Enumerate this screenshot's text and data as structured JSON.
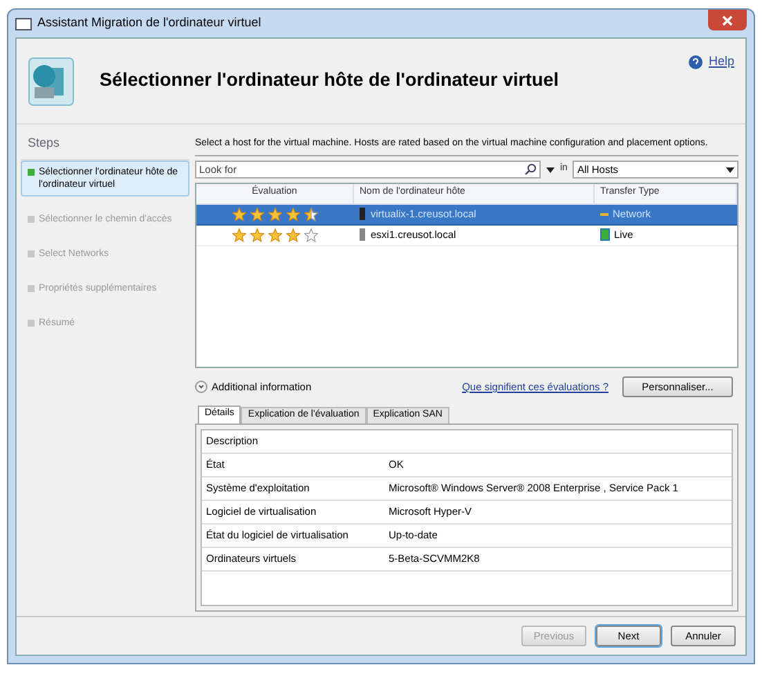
{
  "window": {
    "title": "Assistant Migration de l'ordinateur virtuel"
  },
  "header": {
    "title": "Sélectionner l'ordinateur hôte de l'ordinateur virtuel",
    "help": "Help"
  },
  "steps": {
    "title": "Steps",
    "items": [
      {
        "label": "Sélectionner l'ordinateur hôte de l'ordinateur virtuel",
        "selected": true
      },
      {
        "label": "Sélectionner le chemin d'accès",
        "selected": false
      },
      {
        "label": "Select Networks",
        "selected": false
      },
      {
        "label": "Propriétés supplémentaires",
        "selected": false
      },
      {
        "label": "Résumé",
        "selected": false
      }
    ]
  },
  "instruction": "Select a host for the virtual machine. Hosts are rated based on the virtual machine configuration and placement options.",
  "search": {
    "placeholder": "Look for",
    "in_label": "in",
    "scope": "All Hosts"
  },
  "hosts": {
    "columns": [
      "Évaluation",
      "Nom de l'ordinateur hôte",
      "Transfer Type"
    ],
    "rows": [
      {
        "stars": 4.5,
        "name": "virtualix-1.creusot.local",
        "transfer": "Network",
        "selected": true
      },
      {
        "stars": 4,
        "name": "esxi1.creusot.local",
        "transfer": "Live",
        "selected": false
      }
    ]
  },
  "additional_info": "Additional information",
  "ratings_link": "Que signifient ces évaluations ?",
  "customize_button": "Personnaliser...",
  "tabs": [
    {
      "label": "Détails",
      "selected": true
    },
    {
      "label": "Explication de l'évaluation",
      "selected": false
    },
    {
      "label": "Explication SAN",
      "selected": false
    }
  ],
  "details": {
    "heading": "Description",
    "rows": [
      {
        "label": "État",
        "value": "OK"
      },
      {
        "label": "Système d'exploitation",
        "value": "Microsoft® Windows Server® 2008 Enterprise , Service Pack 1"
      },
      {
        "label": "Logiciel de virtualisation",
        "value": "Microsoft Hyper-V"
      },
      {
        "label": "État du logiciel de virtualisation",
        "value": "Up-to-date"
      },
      {
        "label": "Ordinateurs virtuels",
        "value": "5-Beta-SCVMM2K8"
      }
    ]
  },
  "buttons": [
    {
      "label": "Previous",
      "disabled": true,
      "default": false
    },
    {
      "label": "Next",
      "disabled": false,
      "default": true
    },
    {
      "label": "Annuler",
      "disabled": false,
      "default": false
    }
  ]
}
